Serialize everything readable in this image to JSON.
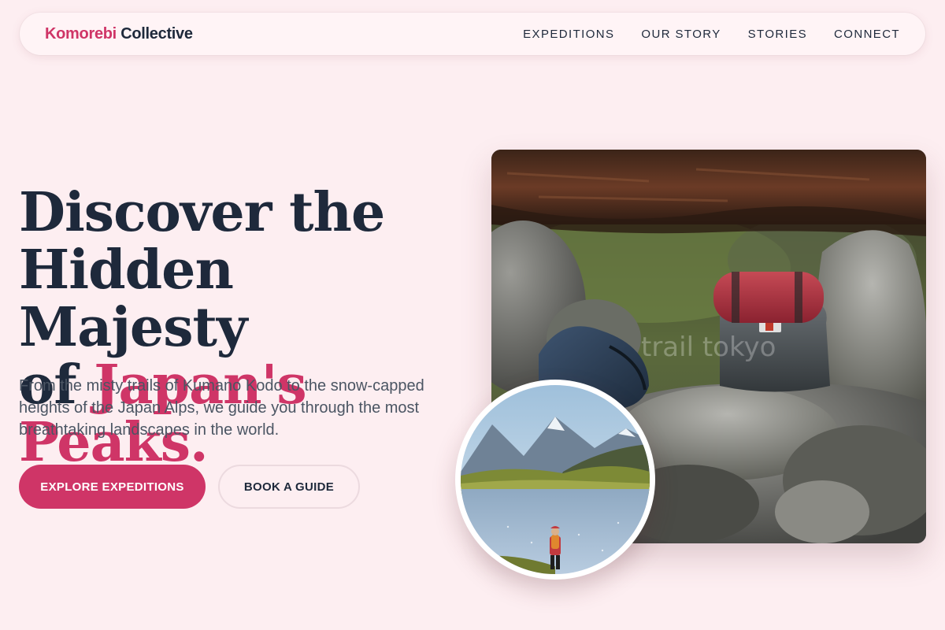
{
  "brand": {
    "part1": "Komorebi",
    "part2": "Collective"
  },
  "nav": {
    "links": [
      "EXPEDITIONS",
      "OUR STORY",
      "STORIES",
      "CONNECT"
    ]
  },
  "hero": {
    "title_line1": "Discover the",
    "title_line2": "Hidden Majesty",
    "title_line3_prefix": "of ",
    "title_line3_accent": "Japan's Peaks.",
    "subtitle": "From the misty trails of Kumano Kodo to the snow-capped heights of the Japan Alps, we guide you through the most breathtaking landscapes in the world."
  },
  "buttons": {
    "primary": "EXPLORE EXPEDITIONS",
    "secondary": "BOOK A GUIDE"
  },
  "images": {
    "main": {
      "icon": "backpack-on-rocks-photo",
      "watermark": "trail tokyo"
    },
    "circle": {
      "icon": "hiker-mountain-lake-photo"
    }
  },
  "colors": {
    "accent": "#cf3567",
    "background": "#fdeef1",
    "text": "#1e293b"
  }
}
